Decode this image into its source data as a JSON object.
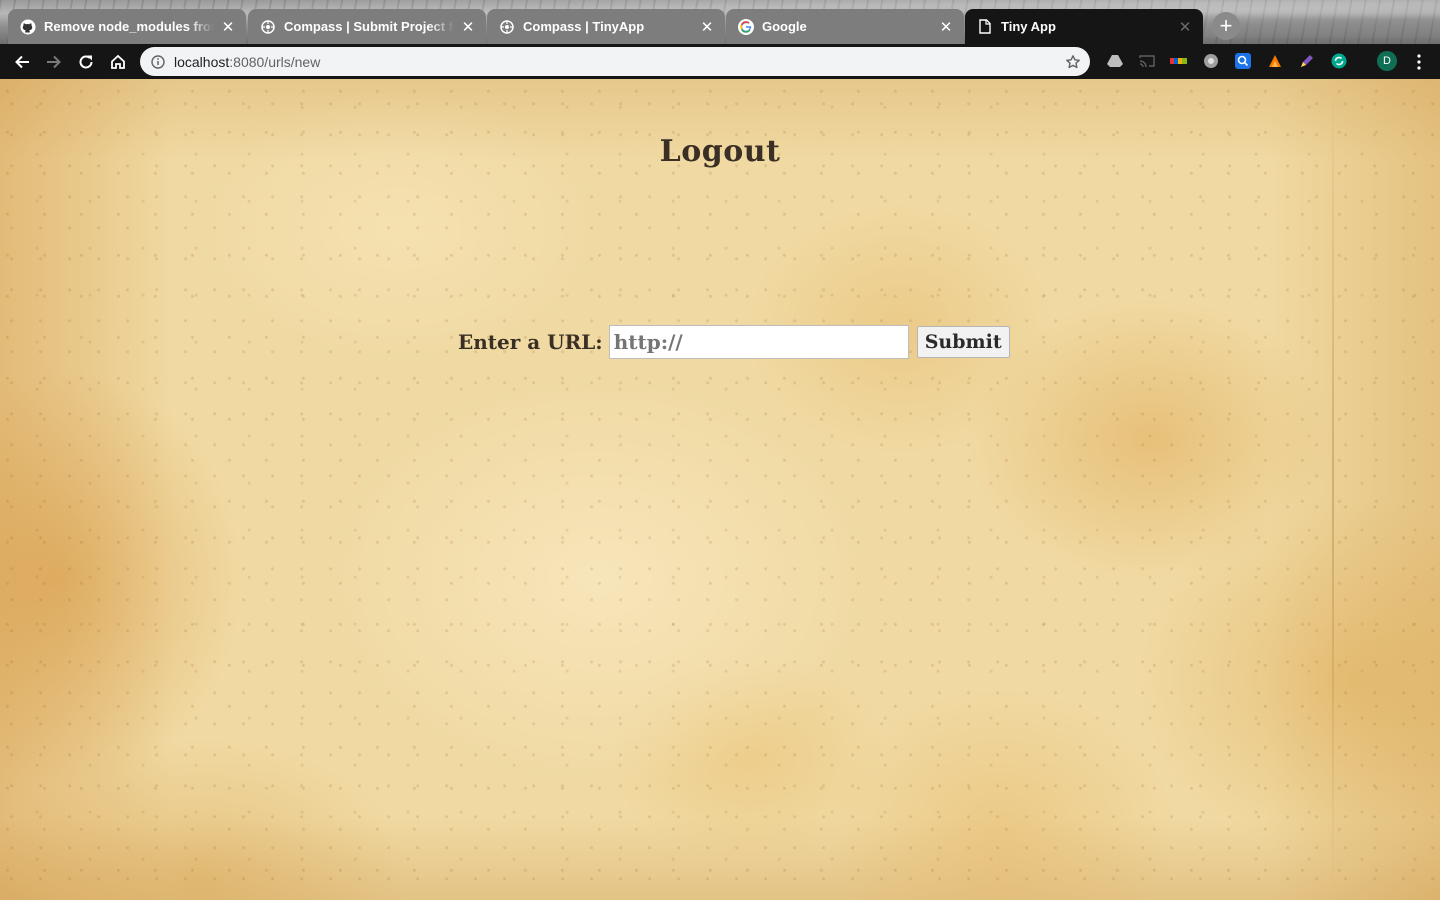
{
  "browser": {
    "tabs": [
      {
        "title": "Remove node_modules from gi",
        "favicon": "github-icon",
        "active": false
      },
      {
        "title": "Compass | Submit Project for E",
        "favicon": "compass-icon",
        "active": false
      },
      {
        "title": "Compass | TinyApp",
        "favicon": "compass-icon",
        "active": false
      },
      {
        "title": "Google",
        "favicon": "google-icon",
        "active": false
      },
      {
        "title": "Tiny App",
        "favicon": "document-icon",
        "active": true
      }
    ],
    "new_tab_label": "+",
    "address": {
      "host": "localhost",
      "path": ":8080/urls/new"
    },
    "profile_initial": "D",
    "extensions": [
      "drive-icon",
      "cast-icon",
      "ebay-icon",
      "extension-circle-icon",
      "search-extension-icon",
      "fox-extension-icon",
      "pen-extension-icon",
      "sync-extension-icon"
    ]
  },
  "page": {
    "logout_label": "Logout",
    "form": {
      "label": "Enter a URL:",
      "input_placeholder": "http://",
      "input_value": "",
      "submit_label": "Submit"
    }
  },
  "colors": {
    "tab_active": "#151515",
    "tab_inactive": "#7d7d7d",
    "paper": "#f0d9a2",
    "text_dark": "#3a2f25",
    "profile": "#0f6e53"
  }
}
